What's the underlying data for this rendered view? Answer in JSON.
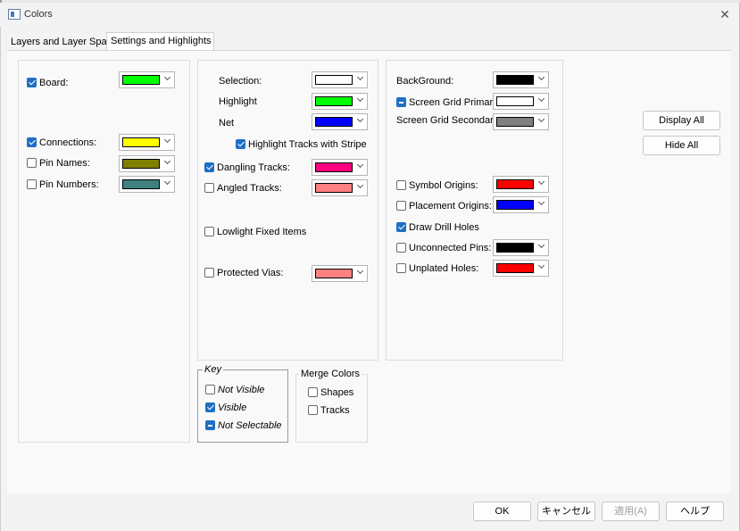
{
  "window": {
    "title": "Colors"
  },
  "tabs": [
    {
      "label": "Layers and Layer Spans",
      "active": false
    },
    {
      "label": "Settings and Highlights",
      "active": true
    }
  ],
  "left_panel": {
    "board": {
      "label": "Board:",
      "checked": true,
      "color": "#00ff00"
    },
    "connections": {
      "label": "Connections:",
      "checked": true,
      "color": "#ffff00"
    },
    "pin_names": {
      "label": "Pin Names:",
      "checked": false,
      "color": "#808000"
    },
    "pin_numbers": {
      "label": "Pin Numbers:",
      "checked": false,
      "color": "#408080"
    }
  },
  "middle_panel": {
    "selection": {
      "label": "Selection:",
      "color": "#ffffff"
    },
    "highlight": {
      "label": "Highlight",
      "color": "#00ff00"
    },
    "net": {
      "label": "Net",
      "color": "#0000ff"
    },
    "highlight_stripe": {
      "label": "Highlight Tracks with Stripe",
      "checked": true
    },
    "dangling_tracks": {
      "label": "Dangling Tracks:",
      "checked": true,
      "color": "#ff0080"
    },
    "angled_tracks": {
      "label": "Angled Tracks:",
      "checked": false,
      "color": "#ff8080"
    },
    "lowlight_fixed": {
      "label": "Lowlight Fixed Items",
      "checked": false
    },
    "protected_vias": {
      "label": "Protected Vias:",
      "checked": false,
      "color": "#ff8080"
    }
  },
  "right_panel": {
    "background": {
      "label": "BackGround:",
      "color": "#000000"
    },
    "screen_grid_primary": {
      "label": "Screen Grid Primary:",
      "state": "indeterminate",
      "color": "#ffffff"
    },
    "screen_grid_secondary": {
      "label": "Screen Grid Secondary:",
      "color": "#808080"
    },
    "symbol_origins": {
      "label": "Symbol Origins:",
      "checked": false,
      "color": "#ff0000"
    },
    "placement_origins": {
      "label": "Placement Origins:",
      "checked": false,
      "color": "#0000ff"
    },
    "draw_drill_holes": {
      "label": "Draw Drill Holes",
      "checked": true
    },
    "unconnected_pins": {
      "label": "Unconnected Pins:",
      "checked": false,
      "color": "#000000"
    },
    "unplated_holes": {
      "label": "Unplated Holes:",
      "checked": false,
      "color": "#ff0000"
    }
  },
  "side_buttons": {
    "display_all": "Display All",
    "hide_all": "Hide All"
  },
  "key_group": {
    "title": "Key",
    "not_visible": "Not Visible",
    "visible": "Visible",
    "not_selectable": "Not Selectable"
  },
  "merge_group": {
    "title": "Merge Colors",
    "shapes": {
      "label": "Shapes",
      "checked": false
    },
    "tracks": {
      "label": "Tracks",
      "checked": false
    }
  },
  "footer": {
    "ok": "OK",
    "cancel": "キャンセル",
    "apply": "適用(A)",
    "help": "ヘルプ"
  }
}
